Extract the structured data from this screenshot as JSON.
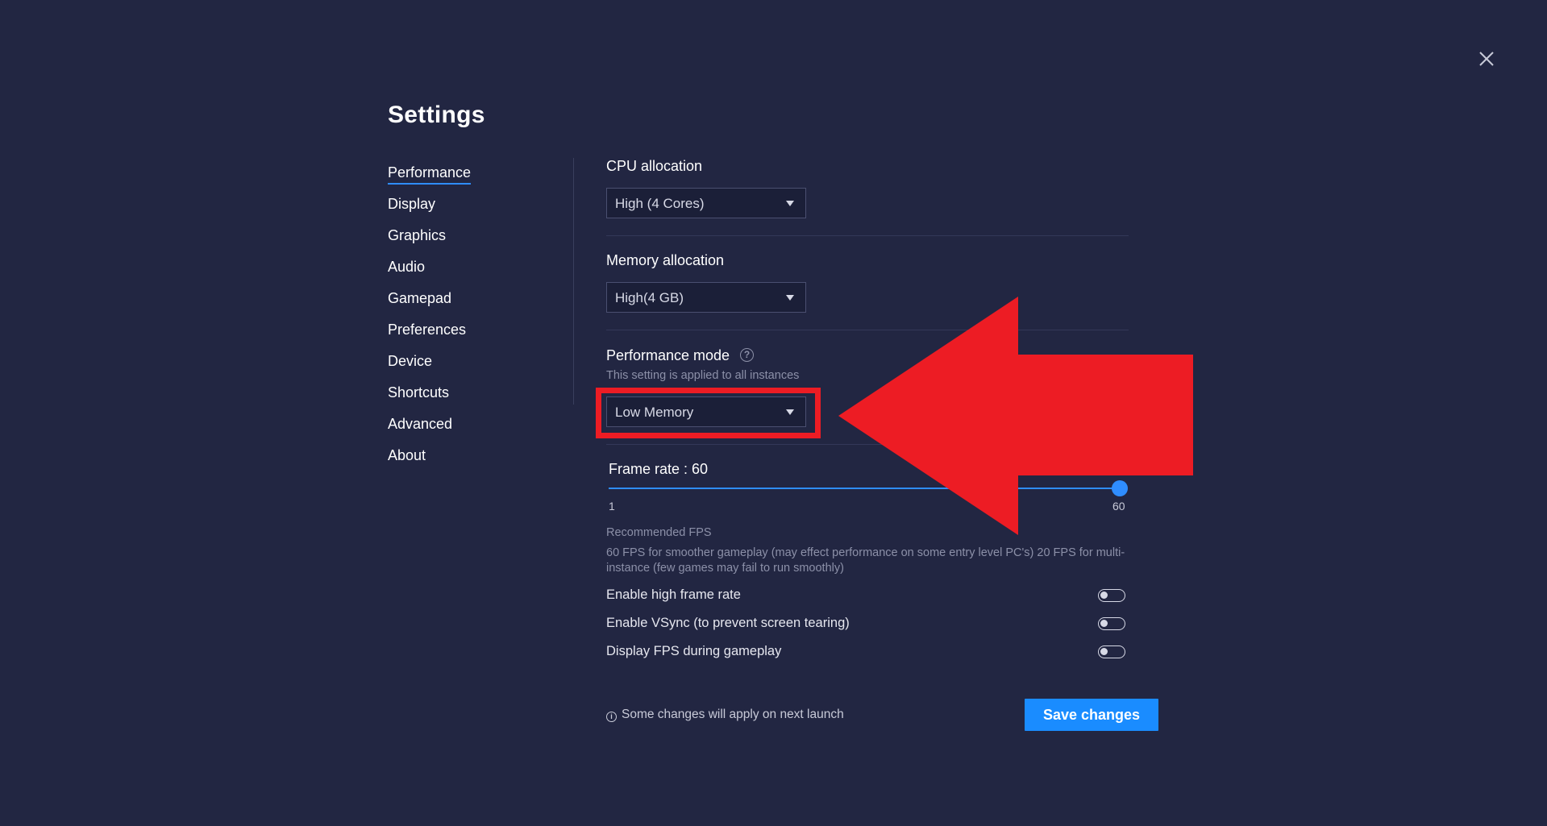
{
  "window": {
    "title": "Settings",
    "close_label": "Close"
  },
  "sidebar": {
    "items": [
      {
        "label": "Performance",
        "active": true
      },
      {
        "label": "Display"
      },
      {
        "label": "Graphics"
      },
      {
        "label": "Audio"
      },
      {
        "label": "Gamepad"
      },
      {
        "label": "Preferences"
      },
      {
        "label": "Device"
      },
      {
        "label": "Shortcuts"
      },
      {
        "label": "Advanced"
      },
      {
        "label": "About"
      }
    ]
  },
  "performance": {
    "cpu": {
      "label": "CPU allocation",
      "value": "High (4 Cores)"
    },
    "memory": {
      "label": "Memory allocation",
      "value": "High(4 GB)"
    },
    "mode": {
      "label": "Performance mode",
      "note": "This setting is applied to all instances",
      "value": "Low Memory"
    },
    "frame_rate": {
      "label": "Frame rate : 60",
      "value": 60,
      "min_label": "1",
      "max_label": "60"
    },
    "recommended": {
      "title": "Recommended FPS",
      "text": "60 FPS for smoother gameplay (may effect performance on some entry level PC's) 20 FPS for multi-instance (few games may fail to run smoothly)"
    },
    "toggles": [
      {
        "label": "Enable high frame rate",
        "on": false
      },
      {
        "label": "Enable VSync (to prevent screen tearing)",
        "on": false
      },
      {
        "label": "Display FPS during gameplay",
        "on": false
      }
    ]
  },
  "footer": {
    "note": "Some changes will apply on next launch",
    "save_label": "Save changes"
  },
  "colors": {
    "background": "#222642",
    "accent": "#1a8cff",
    "annotation": "#ed1c24"
  },
  "icons": {
    "close": "close-icon",
    "help": "help-icon",
    "info": "info-icon",
    "caret": "chevron-down-icon"
  }
}
